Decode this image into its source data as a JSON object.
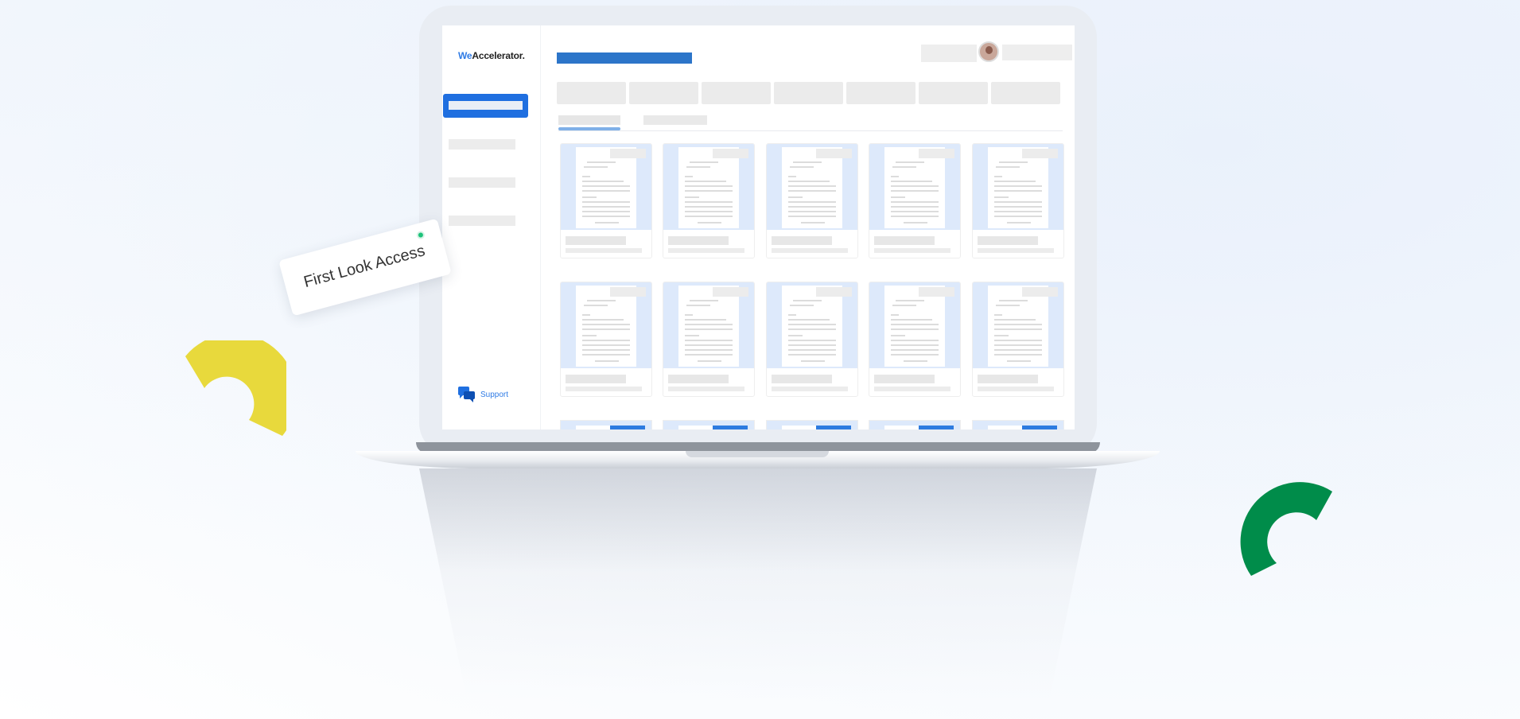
{
  "brand": {
    "logo_prefix": "We",
    "logo_main": "Accelerator."
  },
  "sidebar": {
    "support_label": "Support"
  },
  "badge": {
    "label": "First Look Access"
  },
  "colors": {
    "accent": "#1f6fe0",
    "title_bar": "#2c75c9",
    "status_dot": "#1ec27a",
    "deco_yellow": "#e8d93c",
    "deco_green": "#008c4a"
  },
  "icons": {
    "support": "chat-bubbles-icon",
    "avatar": "user-avatar"
  }
}
